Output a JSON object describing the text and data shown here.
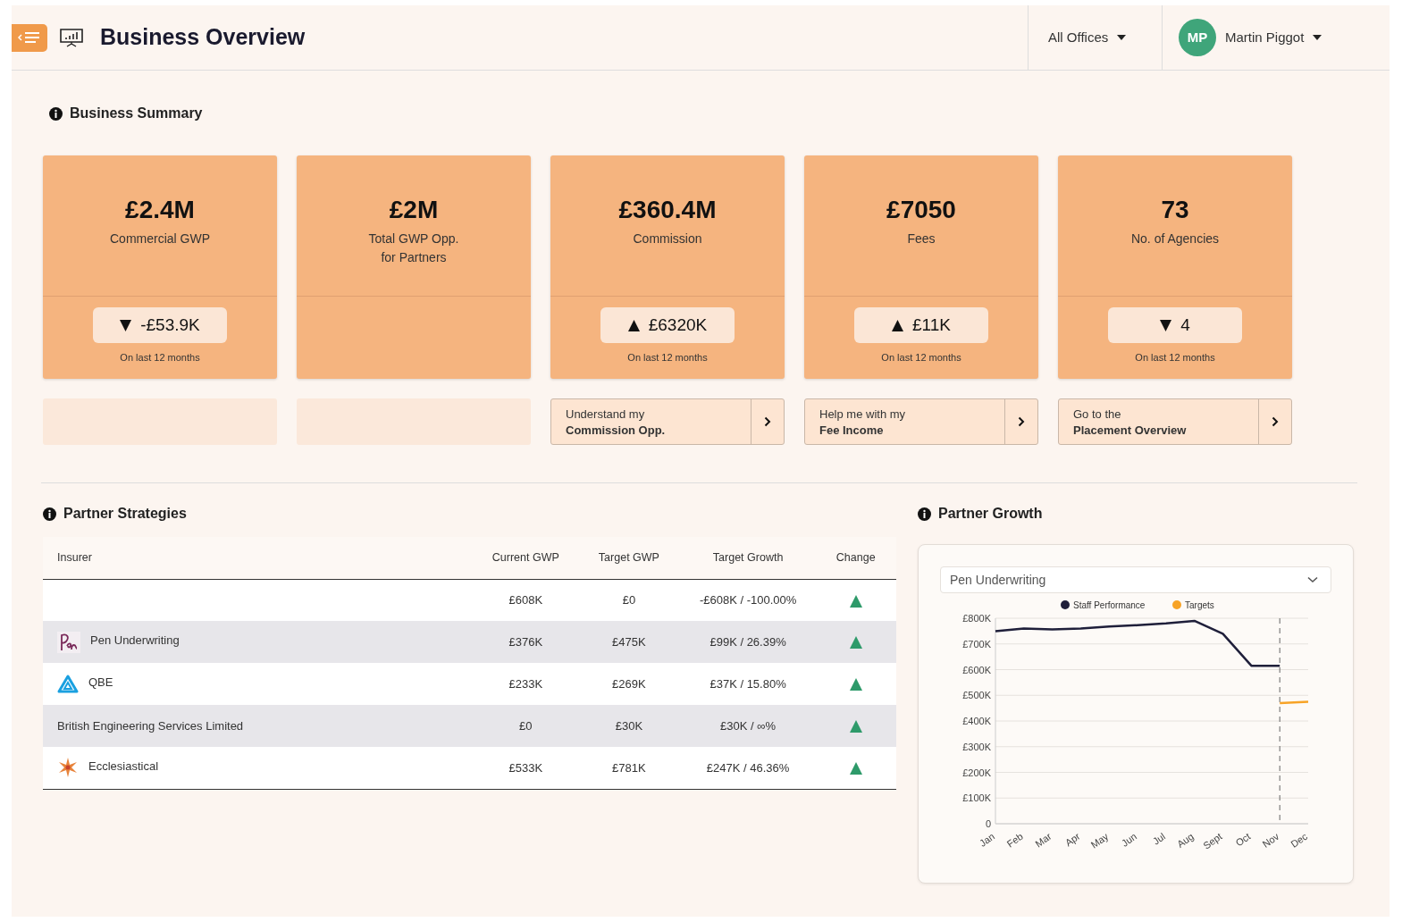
{
  "header": {
    "title": "Business Overview",
    "office_filter": "All Offices",
    "user": {
      "initials": "MP",
      "name": "Martin Piggot"
    }
  },
  "summary": {
    "title": "Business Summary",
    "cards": [
      {
        "value": "£2.4M",
        "label": "Commercial GWP",
        "change": {
          "kind": "down",
          "text": "-£53.9K",
          "note": "On last 12 months"
        }
      },
      {
        "value": "£2M",
        "label": "Total GWP Opp.\nfor Partners"
      },
      {
        "value": "£360.4M",
        "label": "Commission",
        "change": {
          "kind": "up",
          "text": "£6320K",
          "note": "On last 12 months"
        },
        "action": {
          "line1": "Understand my",
          "line2": "Commission Opp."
        }
      },
      {
        "value": "£7050",
        "label": "Fees",
        "change": {
          "kind": "up",
          "text": "£11K",
          "note": "On last 12 months"
        },
        "action": {
          "line1": "Help me with my",
          "line2": "Fee Income"
        }
      },
      {
        "value": "73",
        "label": "No. of Agencies",
        "change": {
          "kind": "down",
          "text": "4",
          "note": "On last 12 months"
        },
        "action": {
          "line1": "Go to the",
          "line2": "Placement Overview"
        }
      }
    ]
  },
  "strategies": {
    "title": "Partner Strategies",
    "columns": [
      "Insurer",
      "Current GWP",
      "Target GWP",
      "Target Growth",
      "Change"
    ],
    "rows": [
      {
        "current": "£608K",
        "target": "£0",
        "growth": "-£608K / -100.00%",
        "change": {
          "kind": "up"
        }
      },
      {
        "kind": "pen",
        "insurer": "Pen Underwriting",
        "current": "£376K",
        "target": "£475K",
        "growth": "£99K / 26.39%",
        "change": {
          "kind": "up"
        }
      },
      {
        "kind": "qbe",
        "insurer": "QBE",
        "current": "£233K",
        "target": "£269K",
        "growth": "£37K / 15.80%",
        "change": {
          "kind": "up"
        }
      },
      {
        "insurer": "British Engineering Services Limited",
        "current": "£0",
        "target": "£30K",
        "growth": "£30K / ∞%",
        "change": {
          "kind": "up"
        }
      },
      {
        "kind": "star",
        "insurer": "Ecclesiastical",
        "current": "£533K",
        "target": "£781K",
        "growth": "£247K / 46.36%",
        "change": {
          "kind": "up"
        }
      }
    ]
  },
  "growth": {
    "title": "Partner Growth",
    "partner_select": "Pen Underwriting",
    "chart_data": {
      "type": "line",
      "categories": [
        "Jan",
        "Feb",
        "Mar",
        "Apr",
        "May",
        "Jun",
        "Jul",
        "Aug",
        "Sept",
        "Oct",
        "Nov",
        "Dec"
      ],
      "series": [
        {
          "name": "Staff Performance",
          "color": "#1f1f3a",
          "values": [
            750,
            760,
            757,
            760,
            768,
            773,
            780,
            790,
            740,
            615,
            615,
            null
          ]
        },
        {
          "name": "Targets",
          "color": "#f7a326",
          "values": [
            null,
            null,
            null,
            null,
            null,
            null,
            null,
            null,
            null,
            null,
            470,
            475
          ]
        }
      ],
      "ylim": [
        0,
        800
      ],
      "yticks": [
        {
          "value": 0,
          "label": "0"
        },
        {
          "value": 100,
          "label": "£100K"
        },
        {
          "value": 200,
          "label": "£200K"
        },
        {
          "value": 300,
          "label": "£300K"
        },
        {
          "value": 400,
          "label": "£400K"
        },
        {
          "value": 500,
          "label": "£500K"
        },
        {
          "value": 600,
          "label": "£600K"
        },
        {
          "value": 700,
          "label": "£700K"
        },
        {
          "value": 800,
          "label": "£800K"
        }
      ],
      "grid": true,
      "legend": "top",
      "ref_lines": [
        {
          "axis": "x",
          "value": "Nov"
        }
      ]
    }
  }
}
